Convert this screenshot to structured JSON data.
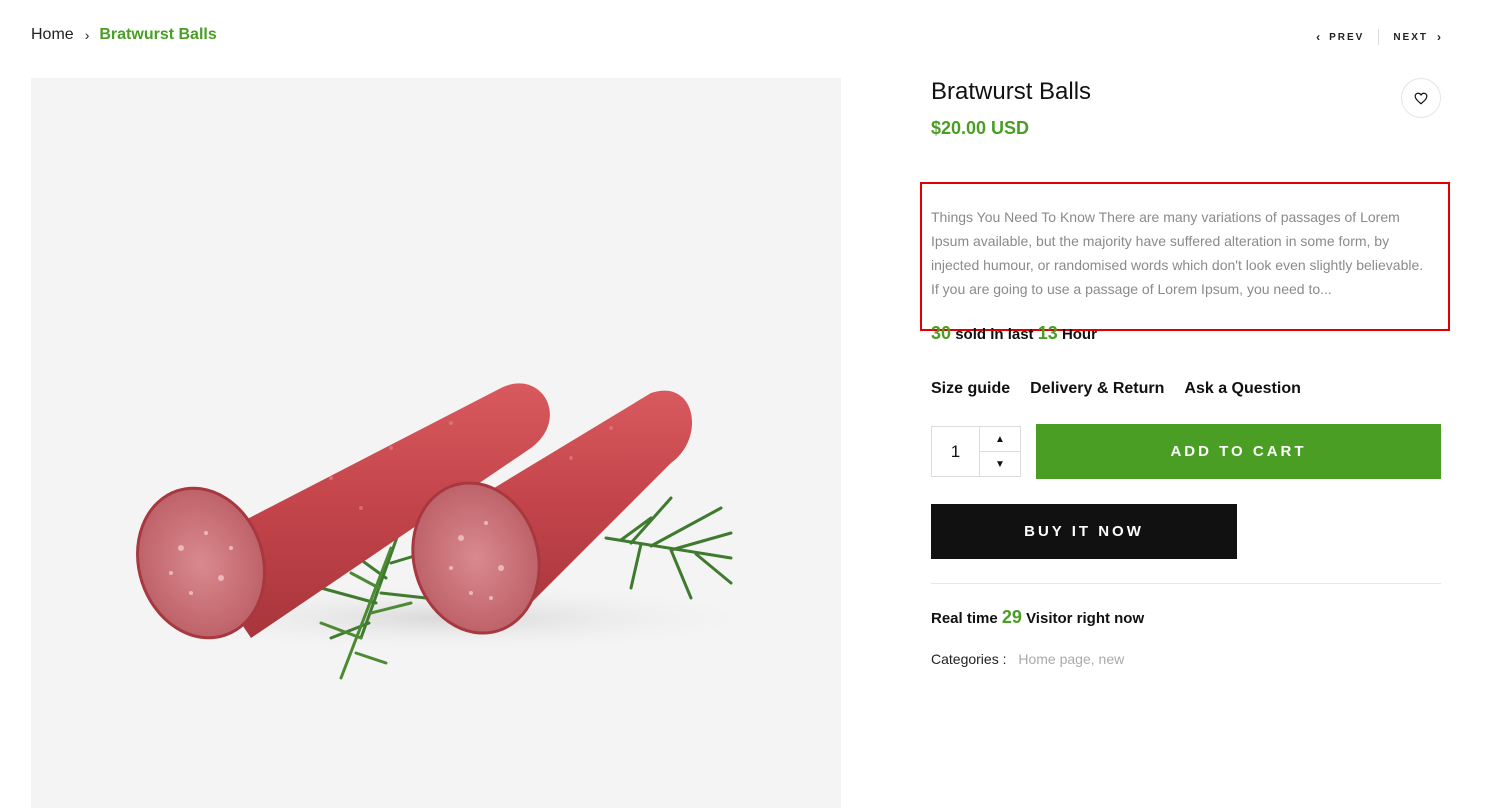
{
  "breadcrumb": {
    "home": "Home",
    "separator": "›",
    "current": "Bratwurst Balls"
  },
  "pager": {
    "prev": "PREV",
    "next": "NEXT"
  },
  "product": {
    "title": "Bratwurst Balls",
    "price": "$20.00 USD",
    "description": "Things You Need To Know There are many variations of passages of Lorem Ipsum available, but the majority have suffered alteration in some form, by injected humour, or randomised words which don't look even slightly believable. If you are going to use a passage of Lorem Ipsum, you need to...",
    "image_alt": "Two sliced sausages with rosemary"
  },
  "sold": {
    "count": "30",
    "mid": "sold in last",
    "hours": "13",
    "suffix": "Hour"
  },
  "links": {
    "size_guide": "Size guide",
    "delivery": "Delivery & Return",
    "ask": "Ask a Question"
  },
  "quantity": {
    "value": "1"
  },
  "buttons": {
    "add_to_cart": "ADD TO CART",
    "buy_now": "BUY IT NOW"
  },
  "visitors": {
    "prefix": "Real time",
    "count": "29",
    "suffix": "Visitor right now"
  },
  "categories": {
    "label": "Categories :",
    "values": "Home page, new"
  },
  "colors": {
    "accent": "#4a9e23",
    "dark": "#111111",
    "highlight_box": "#e00000"
  },
  "icons": {
    "wishlist": "heart-icon",
    "prev": "chevron-left-icon",
    "next": "chevron-right-icon",
    "qty_up": "caret-up-icon",
    "qty_down": "caret-down-icon"
  }
}
